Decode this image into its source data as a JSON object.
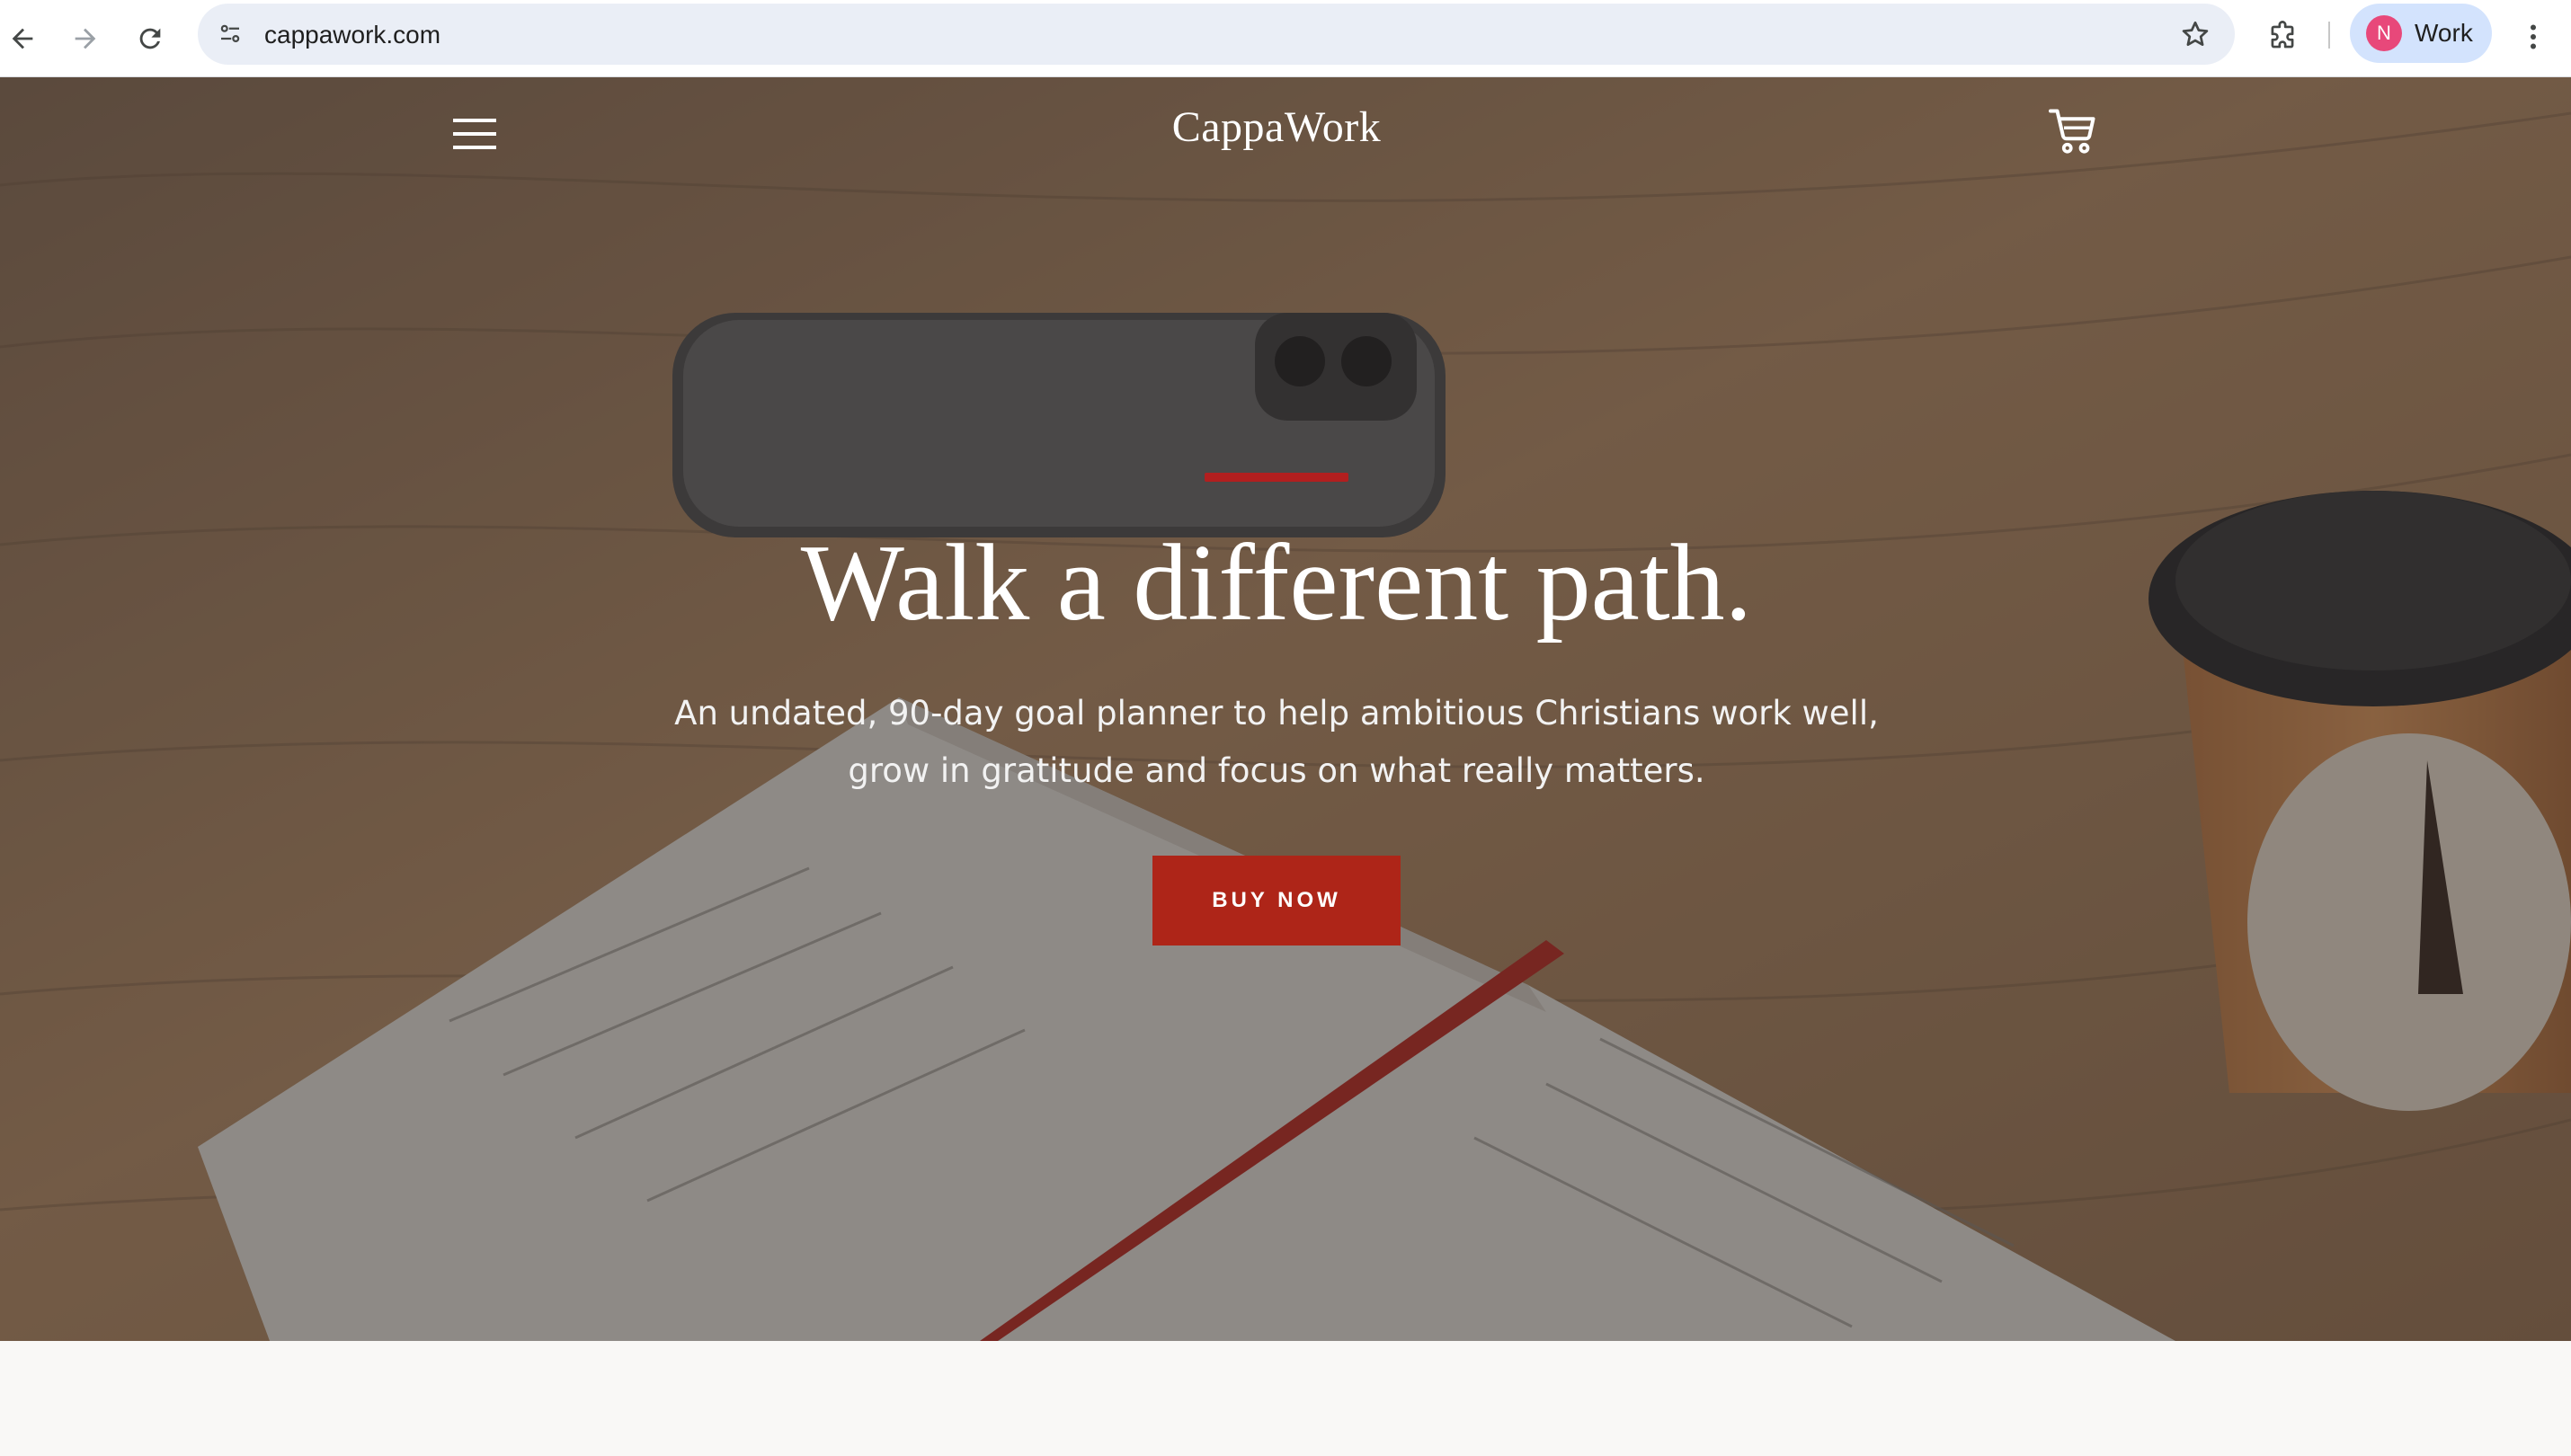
{
  "browser": {
    "url": "cappawork.com",
    "profile_initial": "N",
    "profile_name": "Work",
    "icons": [
      "back-arrow-icon",
      "forward-arrow-icon",
      "reload-icon",
      "site-info-icon",
      "bookmark-star-icon",
      "extensions-icon",
      "more-menu-icon"
    ]
  },
  "site": {
    "brand": "CappaWork",
    "accent_color": "#b21f1f",
    "button_color": "#ae2518",
    "icons": [
      "hamburger-menu-icon",
      "shopping-cart-icon"
    ]
  },
  "hero": {
    "headline": "Walk a different path.",
    "subtext_line1": "An undated, 90-day goal planner to help ambitious Christians work well,",
    "subtext_line2": "grow in gratitude and focus on what really matters.",
    "cta_label": "BUY NOW"
  }
}
